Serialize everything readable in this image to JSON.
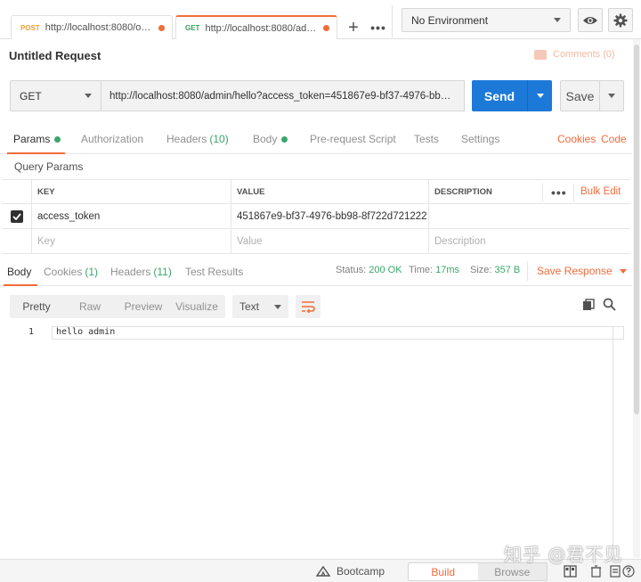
{
  "tabs": [
    {
      "method": "POST",
      "url": "http://localhost:8080/oaut..."
    },
    {
      "method": "GET",
      "url": "http://localhost:8080/admin..."
    }
  ],
  "tab_actions": {
    "add": "+",
    "more": "•••"
  },
  "environment": {
    "selected": "No Environment"
  },
  "request": {
    "title": "Untitled Request",
    "comments_label": "Comments (0)",
    "method": "GET",
    "url": "http://localhost:8080/admin/hello?access_token=451867e9-bf37-4976-bb98...",
    "send_label": "Send",
    "save_label": "Save"
  },
  "request_tabs": {
    "params": "Params",
    "authorization": "Authorization",
    "headers": "Headers",
    "headers_count": "(10)",
    "body": "Body",
    "prerequest": "Pre-request Script",
    "tests": "Tests",
    "settings": "Settings",
    "cookies": "Cookies",
    "code": "Code"
  },
  "query_params": {
    "title": "Query Params",
    "columns": {
      "key": "KEY",
      "value": "VALUE",
      "description": "DESCRIPTION"
    },
    "more": "•••",
    "bulk_edit": "Bulk Edit",
    "rows": [
      {
        "checked": true,
        "key": "access_token",
        "value": "451867e9-bf37-4976-bb98-8f722d721222",
        "description": ""
      }
    ],
    "placeholders": {
      "key": "Key",
      "value": "Value",
      "description": "Description"
    }
  },
  "response_tabs": {
    "body": "Body",
    "cookies": "Cookies",
    "cookies_count": "(1)",
    "headers": "Headers",
    "headers_count": "(11)",
    "test_results": "Test Results"
  },
  "response_meta": {
    "status_label": "Status:",
    "status_value": "200 OK",
    "time_label": "Time:",
    "time_value": "17ms",
    "size_label": "Size:",
    "size_value": "357 B",
    "save_response": "Save Response"
  },
  "response_toolbar": {
    "formats": [
      "Pretty",
      "Raw",
      "Preview",
      "Visualize"
    ],
    "text_mode": "Text"
  },
  "response_body": {
    "lines": [
      {
        "no": "1",
        "text": "hello admin"
      }
    ]
  },
  "statusbar": {
    "bootcamp": "Bootcamp",
    "build": "Build",
    "browse": "Browse"
  },
  "watermark": "知乎 @君不见",
  "colors": {
    "accent": "#f26b3a",
    "send": "#1c79d8",
    "success": "#3aa56a"
  }
}
